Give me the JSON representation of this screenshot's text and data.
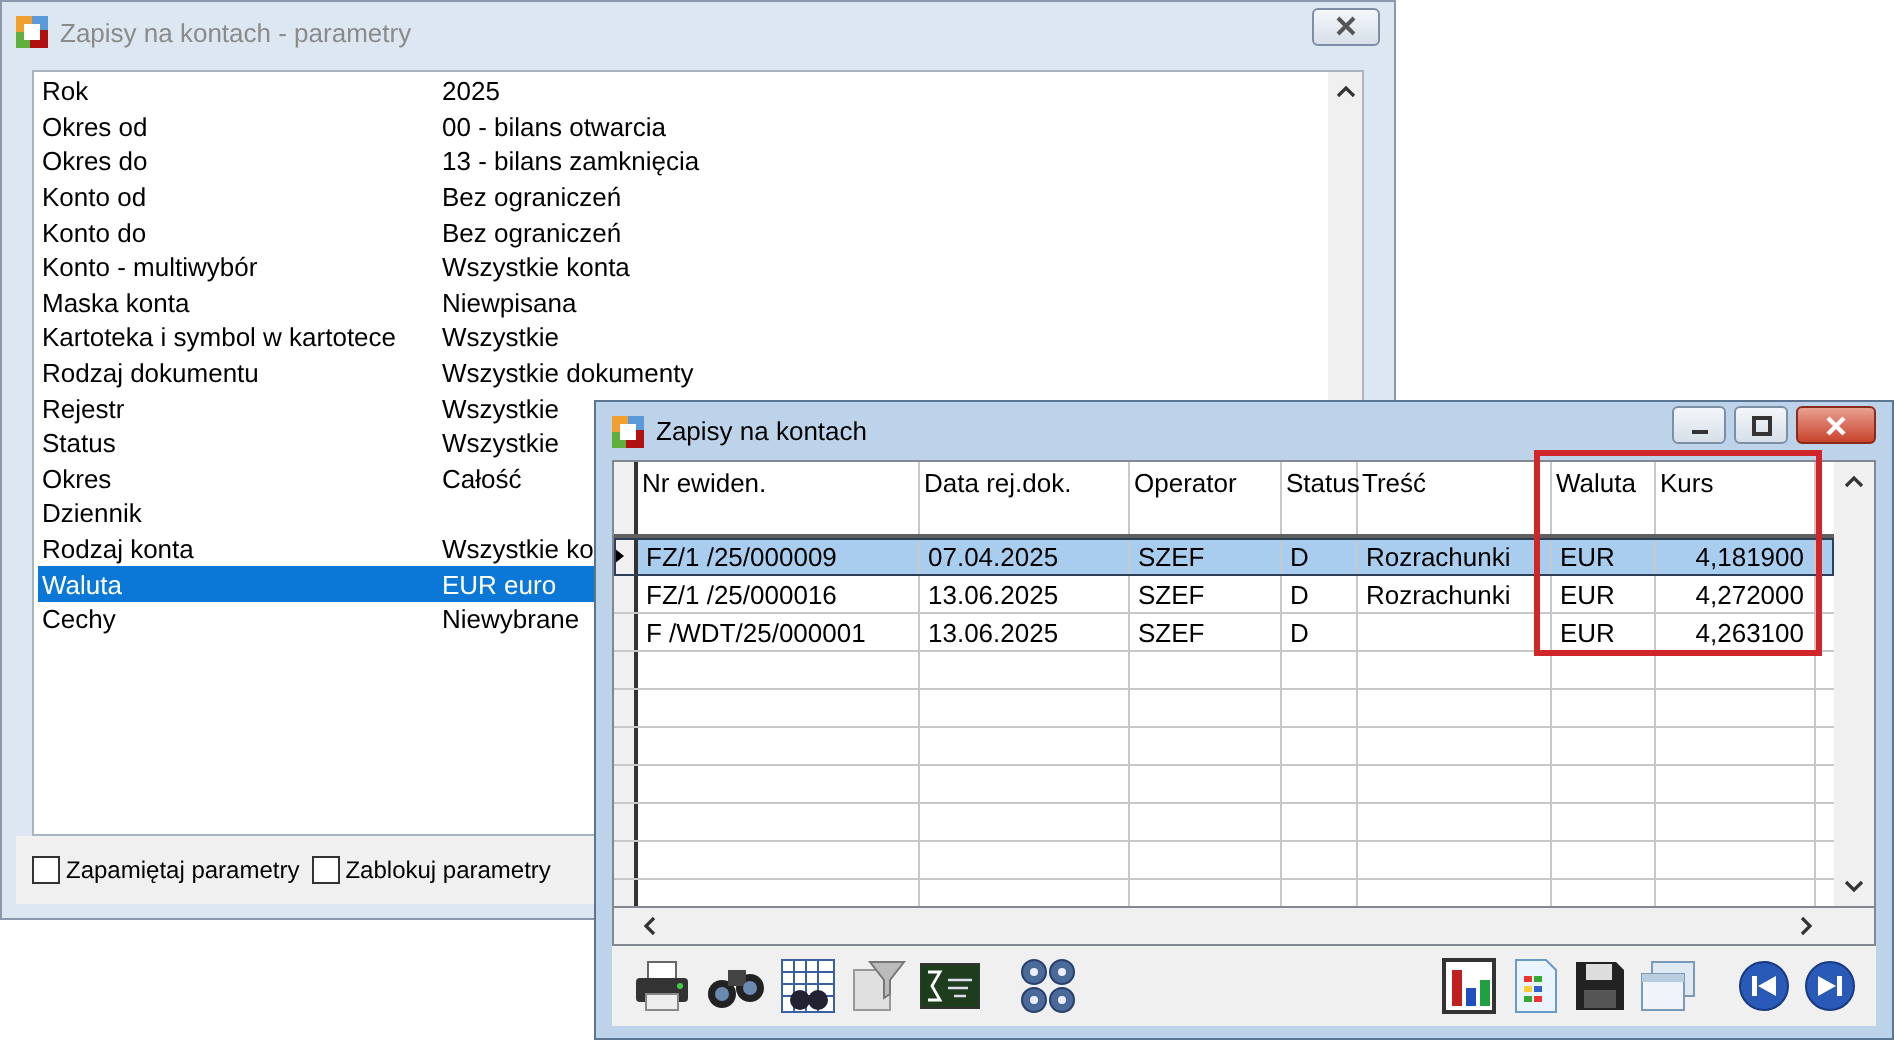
{
  "params_window": {
    "title": "Zapisy na kontach - parametry",
    "rows": [
      {
        "label": "Rok",
        "value": "2025",
        "selected": false
      },
      {
        "label": "Okres od",
        "value": "00 - bilans otwarcia",
        "selected": false
      },
      {
        "label": "Okres do",
        "value": "13 - bilans zamknięcia",
        "selected": false
      },
      {
        "label": "Konto od",
        "value": "Bez ograniczeń",
        "selected": false
      },
      {
        "label": "Konto do",
        "value": "Bez ograniczeń",
        "selected": false
      },
      {
        "label": "Konto - multiwybór",
        "value": "Wszystkie konta",
        "selected": false
      },
      {
        "label": "Maska konta",
        "value": "Niewpisana",
        "selected": false
      },
      {
        "label": "Kartoteka i symbol w kartotece",
        "value": "Wszystkie",
        "selected": false
      },
      {
        "label": "Rodzaj dokumentu",
        "value": "Wszystkie dokumenty",
        "selected": false
      },
      {
        "label": "Rejestr",
        "value": "Wszystkie",
        "selected": false
      },
      {
        "label": "Status",
        "value": "Wszystkie",
        "selected": false
      },
      {
        "label": "Okres",
        "value": "Całość",
        "selected": false
      },
      {
        "label": "Dziennik",
        "selected": false
      },
      {
        "label": "Rodzaj konta",
        "value": "Wszystkie ko",
        "selected": false
      },
      {
        "label": "Waluta",
        "value": "EUR euro",
        "selected": true
      },
      {
        "label": "Cechy",
        "value": "Niewybrane",
        "selected": false
      }
    ],
    "checkboxes": [
      {
        "label": "Zapamiętaj parametry",
        "checked": false
      },
      {
        "label": "Zablokuj parametry",
        "checked": false
      }
    ]
  },
  "entries_window": {
    "title": "Zapisy na kontach",
    "columns": [
      "Nr ewiden.",
      "Data rej.dok.",
      "Operator",
      "Status",
      "Treść",
      "Waluta",
      "Kurs"
    ],
    "rows": [
      {
        "cells": [
          "FZ/1  /25/000009",
          "07.04.2025",
          "SZEF",
          "D",
          "Rozrachunki",
          "EUR",
          "4,181900"
        ],
        "selected": true
      },
      {
        "cells": [
          "FZ/1  /25/000016",
          "13.06.2025",
          "SZEF",
          "D",
          "Rozrachunki",
          "EUR",
          "4,272000"
        ],
        "selected": false
      },
      {
        "cells": [
          "F /WDT/25/000001",
          "13.06.2025",
          "SZEF",
          "D",
          null,
          "EUR",
          "4,263100"
        ],
        "selected": false
      }
    ]
  }
}
